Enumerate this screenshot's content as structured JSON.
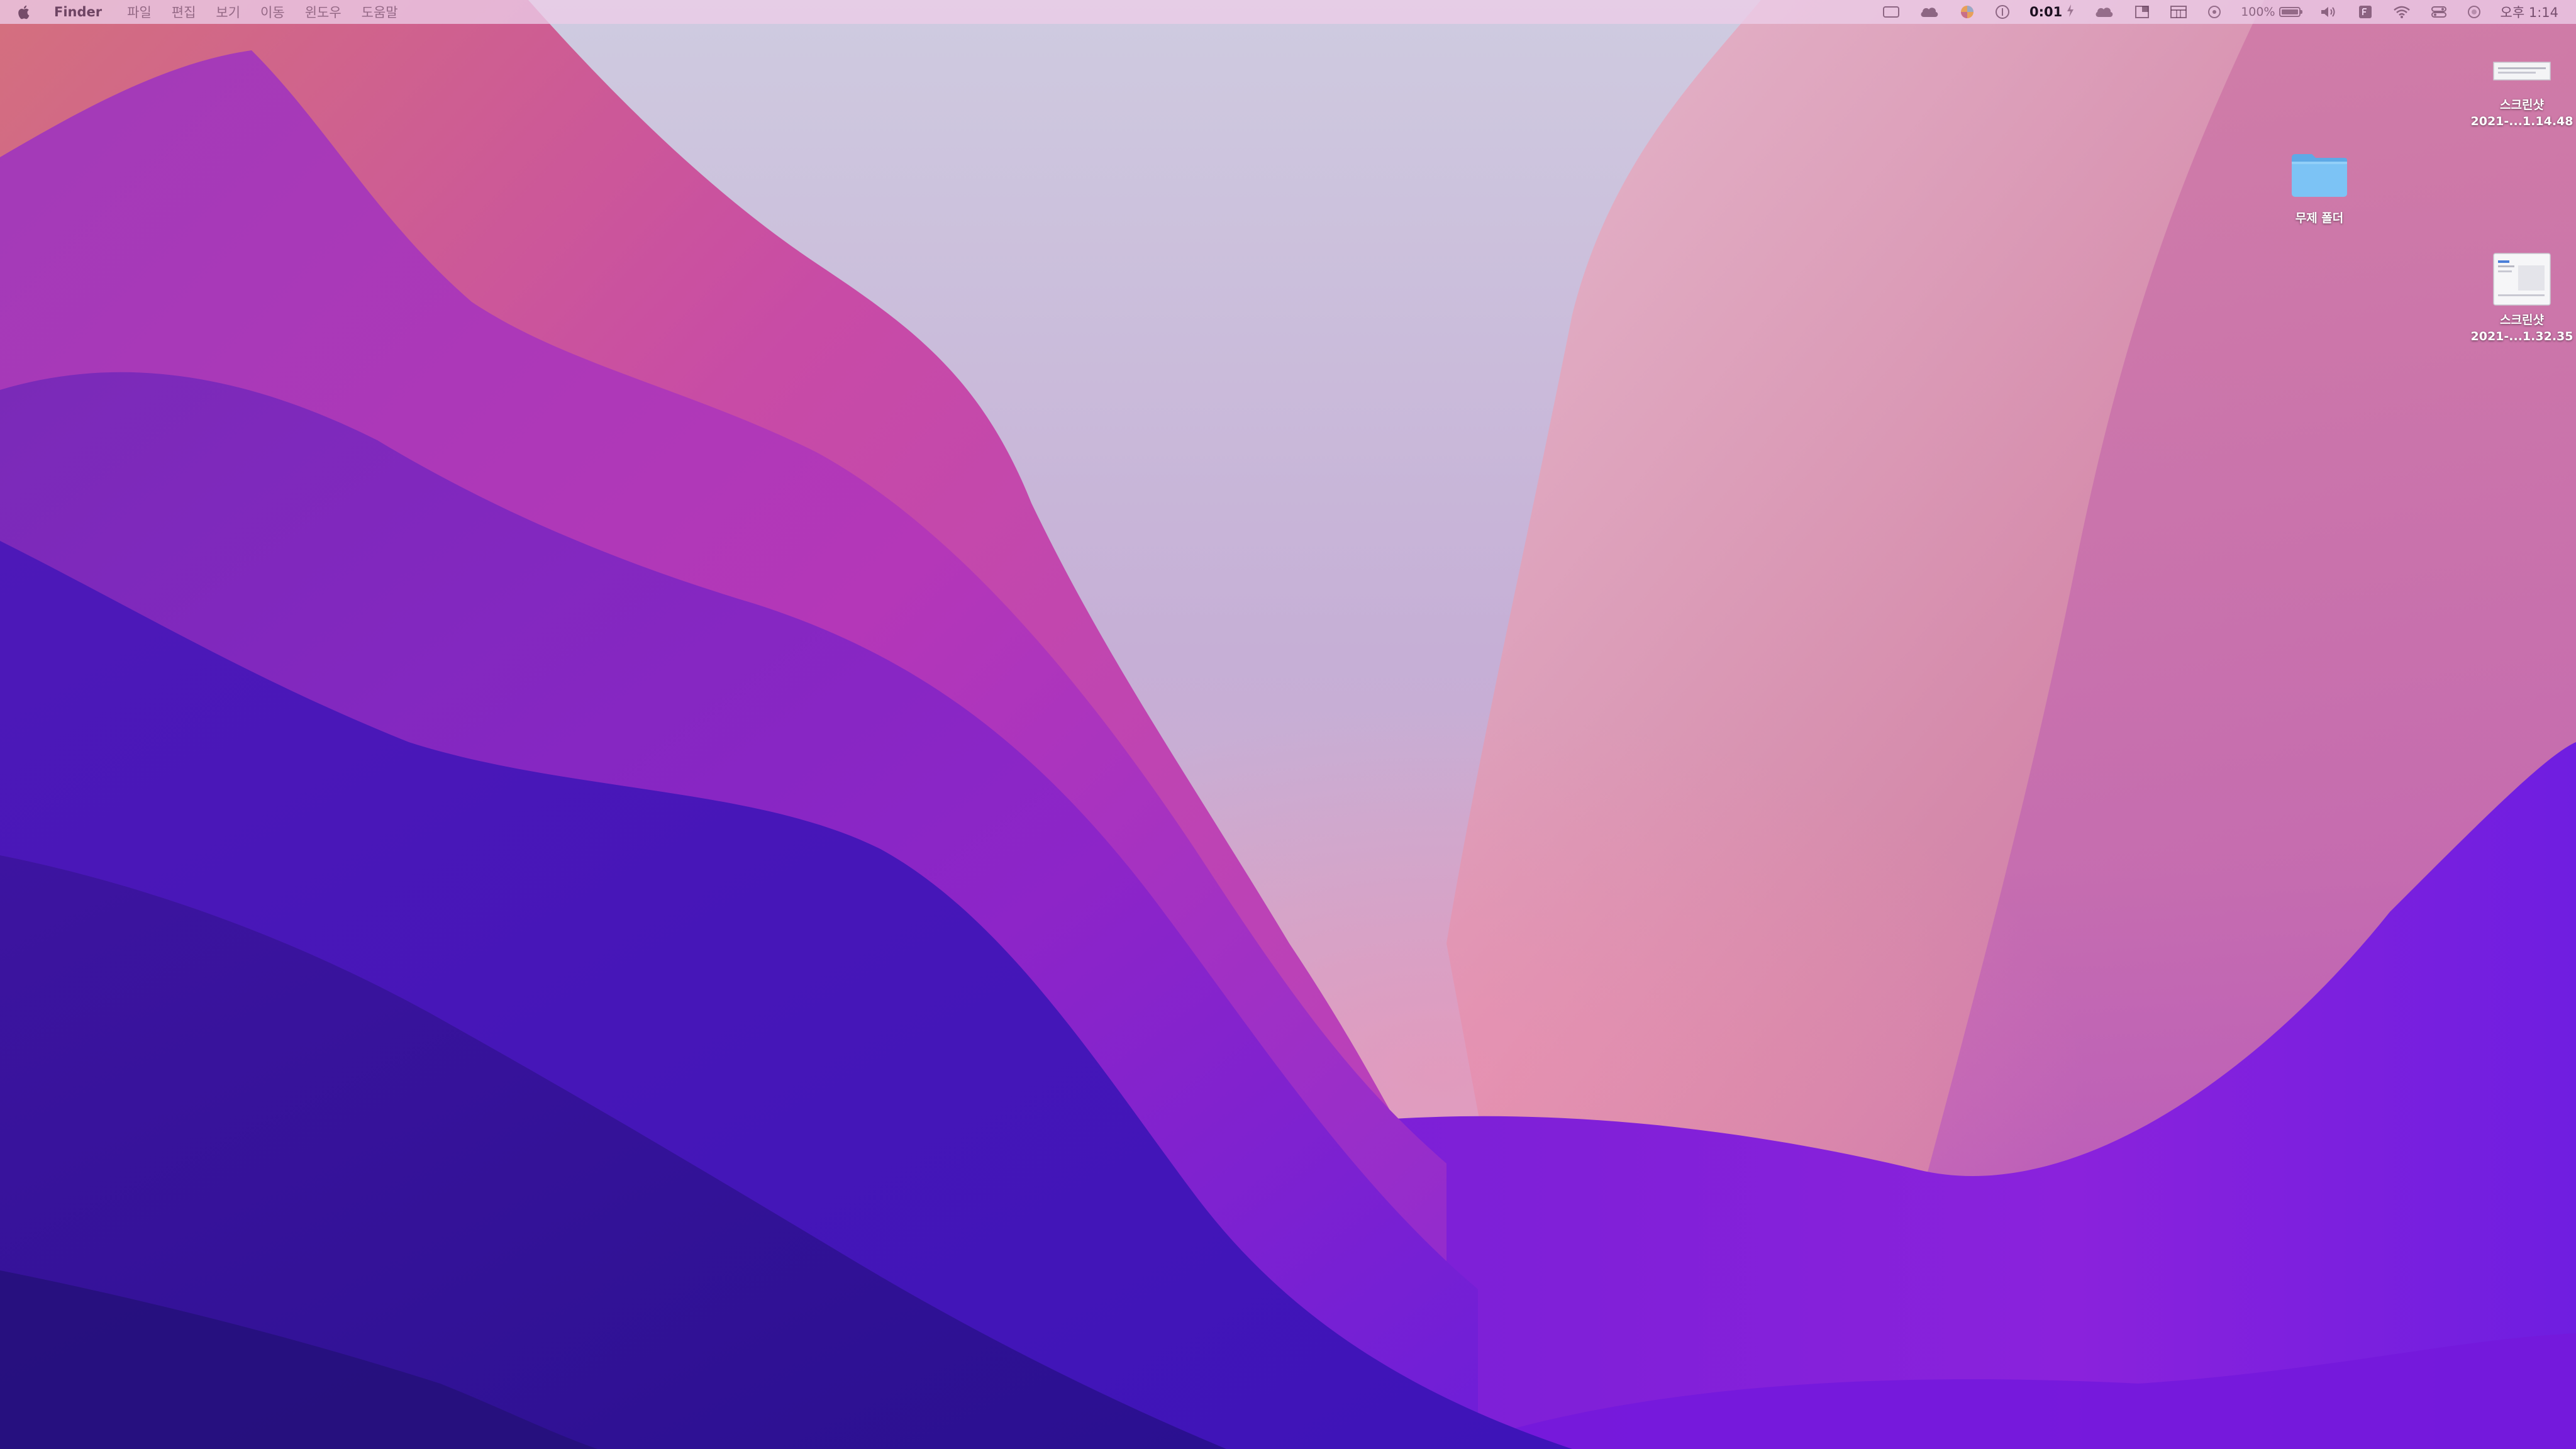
{
  "menubar": {
    "app_name": "Finder",
    "menus": [
      "파일",
      "편집",
      "보기",
      "이동",
      "윈도우",
      "도움말"
    ],
    "status": {
      "timer": "0:01",
      "battery_percent_text": "100%",
      "battery_level": 1.0,
      "clock": "오후 1:14"
    },
    "status_icons": [
      "screen-mirroring-icon",
      "cloud-app-icon",
      "color-wheel-icon",
      "info-circle-icon",
      "bolt-icon",
      "cloud-icon",
      "window-grid-icon",
      "calendar-app-icon",
      "record-icon",
      "battery-icon",
      "volume-icon",
      "keyboard-input-icon",
      "wifi-icon",
      "control-center-icon",
      "siri-icon"
    ]
  },
  "desktop": {
    "icons": [
      {
        "type": "screenshot",
        "line1": "스크린샷",
        "line2": "2021-...1.14.48"
      },
      {
        "type": "folder",
        "line1": "무제 폴더",
        "line2": ""
      },
      {
        "type": "screenshot",
        "line1": "스크린샷",
        "line2": "2021-...1.32.35"
      }
    ]
  },
  "colors": {
    "menubar_bg": "#ECCDE8",
    "folder_blue": "#7CC3F5",
    "wallpaper_deep_violet": "#3A12A8",
    "wallpaper_magenta": "#C03EB4",
    "wallpaper_pink": "#D9809E",
    "wallpaper_lilac": "#C7BCD9"
  }
}
